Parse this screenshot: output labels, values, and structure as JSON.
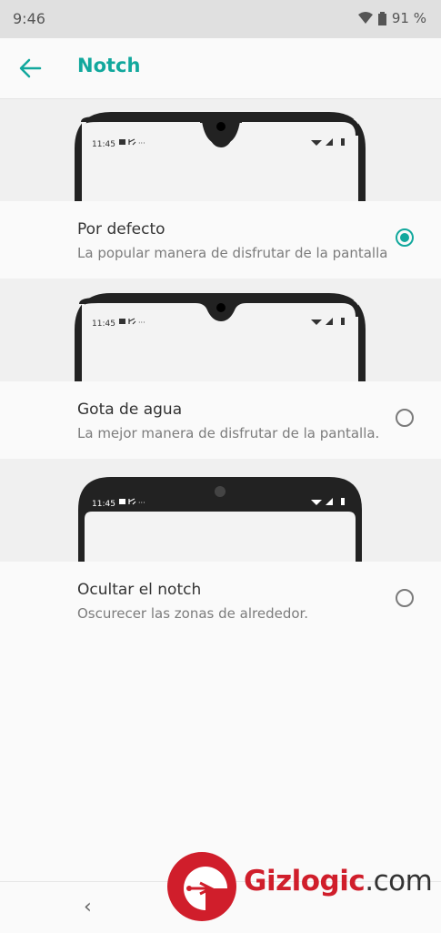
{
  "status": {
    "time": "9:46",
    "battery": "91 %"
  },
  "appbar": {
    "title": "Notch"
  },
  "mock_time": "11:45",
  "options": [
    {
      "title": "Por defecto",
      "subtitle": "La popular manera de disfrutar de la pantalla",
      "selected": true
    },
    {
      "title": "Gota de agua",
      "subtitle": "La mejor manera de disfrutar de la pantalla.",
      "selected": false
    },
    {
      "title": "Ocultar el notch",
      "subtitle": "Oscurecer las zonas de alrededor.",
      "selected": false
    }
  ],
  "watermark": {
    "brand": "Gizlogic",
    "suffix": ".com"
  },
  "colors": {
    "accent": "#12a89d",
    "logo_red": "#d01e2b"
  }
}
